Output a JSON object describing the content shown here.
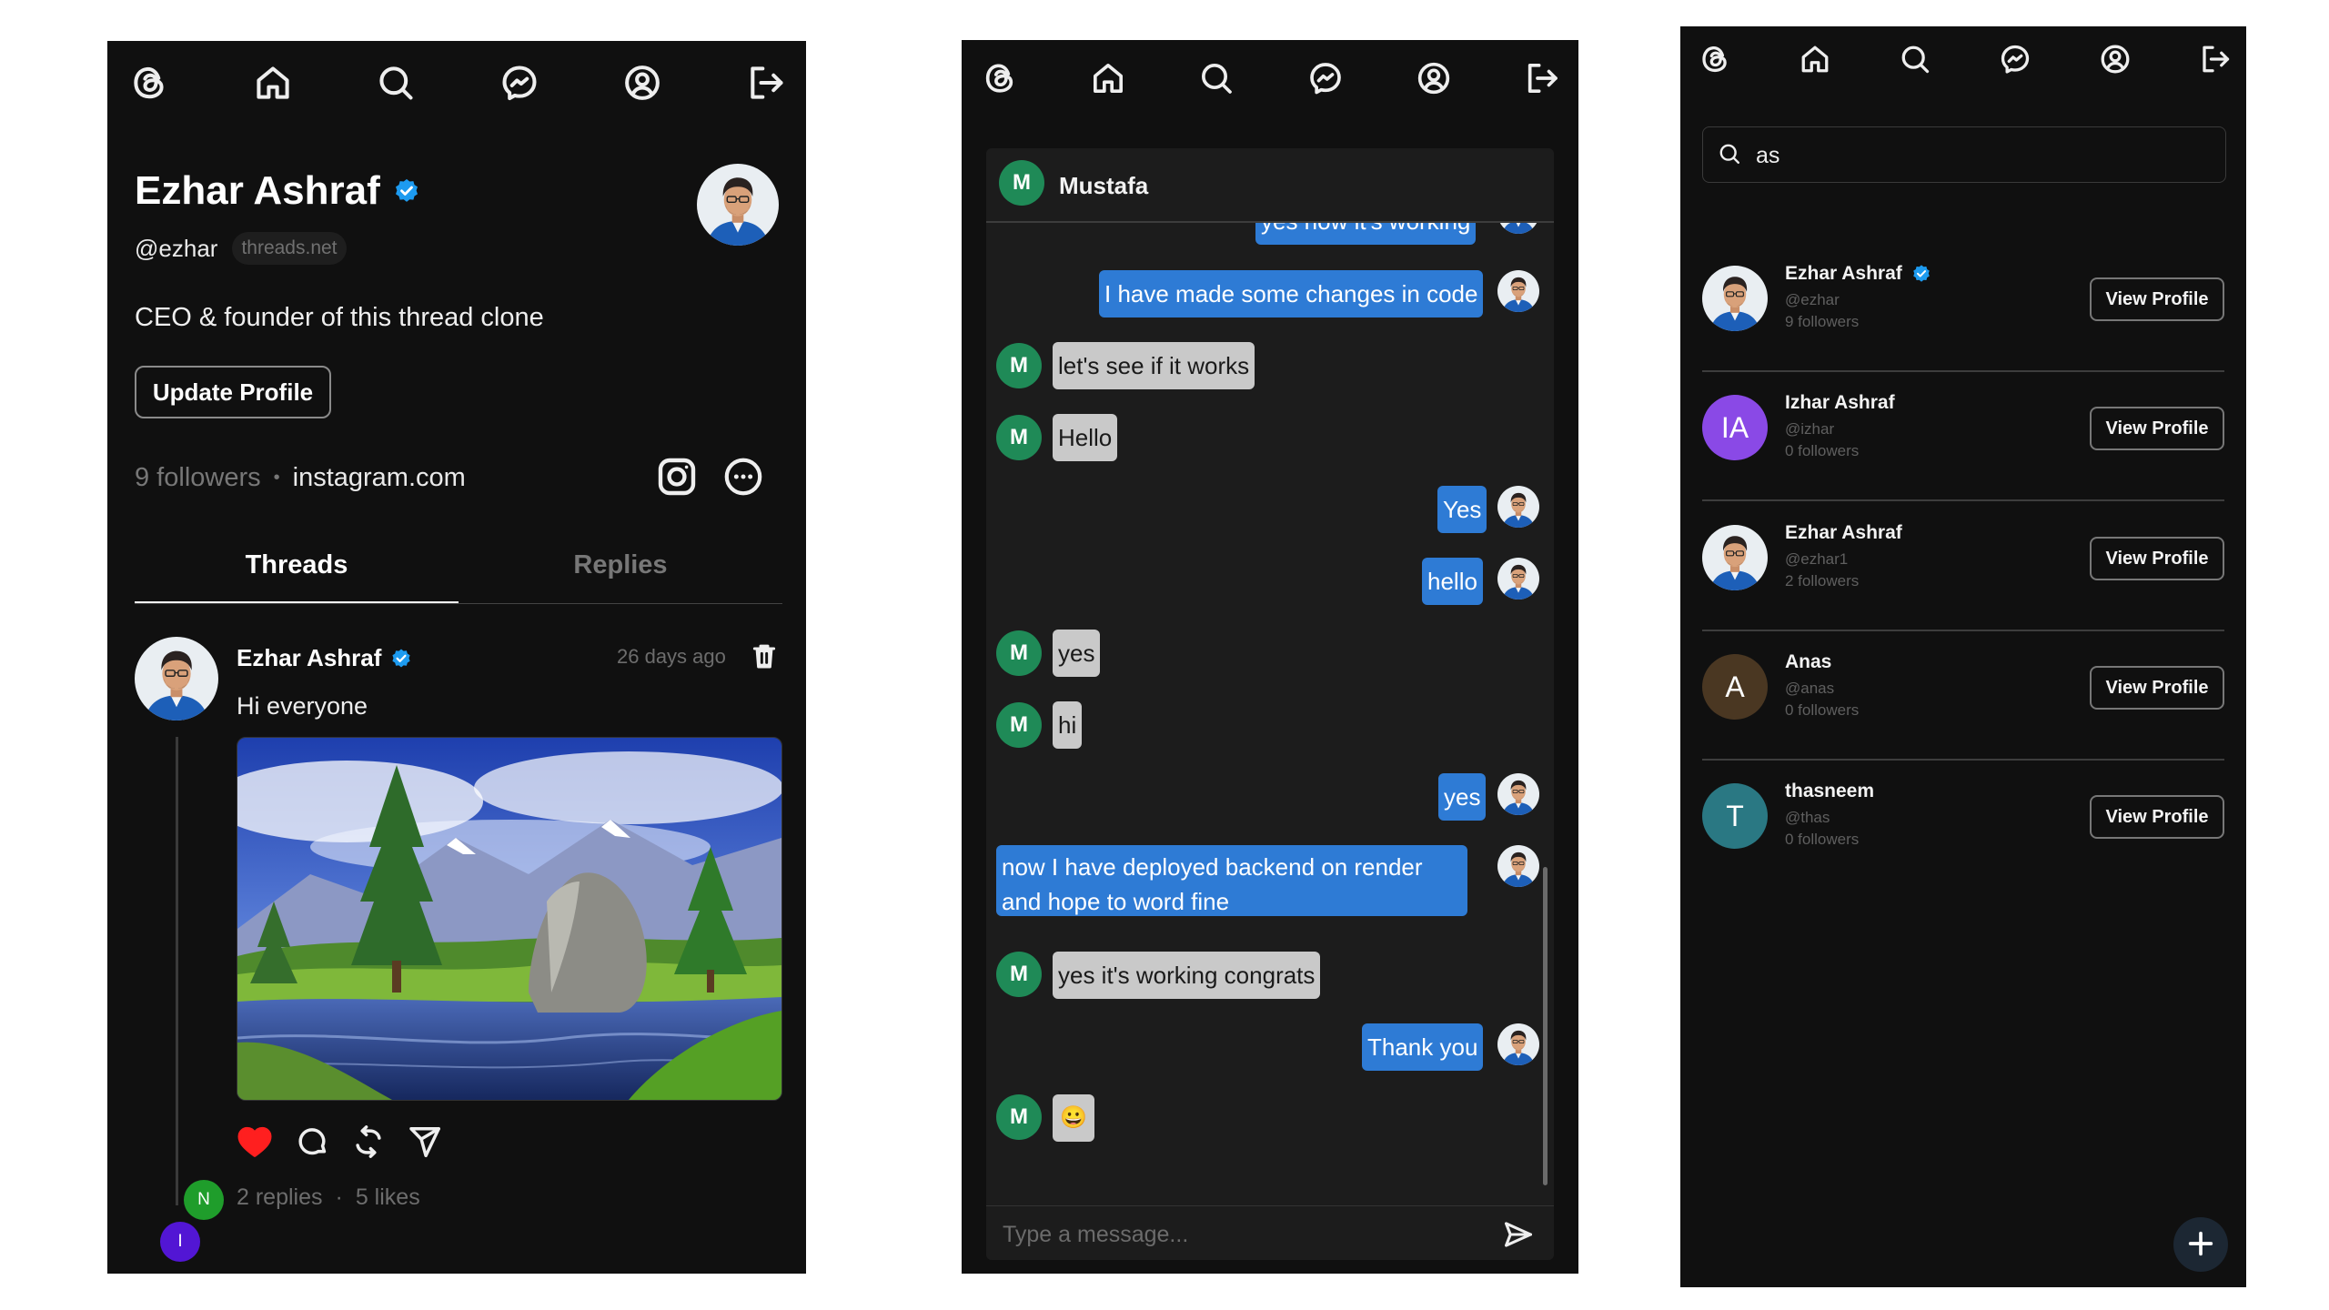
{
  "colors": {
    "verified": "#1d9bf0",
    "my_bubble": "#2e7bd5",
    "their_bubble": "#c9c9c9",
    "mustafa_avatar": "#1f8a57",
    "like_red": "#ff1f1f"
  },
  "nav_icons": [
    "threads-logo-icon",
    "home-icon",
    "search-icon",
    "messenger-icon",
    "profile-icon",
    "logout-icon"
  ],
  "profile": {
    "name": "Ezhar Ashraf",
    "handle": "@ezhar",
    "domain_badge": "threads.net",
    "bio": "CEO & founder of this thread clone",
    "update_button": "Update Profile",
    "followers": "9 followers",
    "separator": "•",
    "website": "instagram.com",
    "tabs": [
      {
        "label": "Threads",
        "active": true
      },
      {
        "label": "Replies",
        "active": false
      }
    ],
    "post": {
      "author": "Ezhar Ashraf",
      "time": "26 days ago",
      "text": "Hi everyone",
      "replies": "2 replies",
      "stats_separator": "·",
      "likes": "5 likes",
      "reply_avatars": [
        "N",
        "I"
      ]
    }
  },
  "chat": {
    "contact": {
      "initial": "M",
      "name": "Mustafa"
    },
    "messages": [
      {
        "from": "me",
        "text": "yes now it's working"
      },
      {
        "from": "me",
        "text": "I have made some changes in code"
      },
      {
        "from": "them",
        "text": "let's see if it works"
      },
      {
        "from": "them",
        "text": "Hello"
      },
      {
        "from": "me",
        "text": "Yes"
      },
      {
        "from": "me",
        "text": "hello"
      },
      {
        "from": "them",
        "text": "yes"
      },
      {
        "from": "them",
        "text": "hi"
      },
      {
        "from": "me",
        "text": "yes"
      },
      {
        "from": "me",
        "text": "now I have deployed backend on render and hope to word fine"
      },
      {
        "from": "them",
        "text": "yes it's working congrats"
      },
      {
        "from": "me",
        "text": "Thank you"
      },
      {
        "from": "them",
        "text": "😀"
      }
    ],
    "input_placeholder": "Type a message..."
  },
  "search": {
    "query": "as",
    "button_label": "View Profile",
    "results": [
      {
        "name": "Ezhar Ashraf",
        "handle": "@ezhar",
        "followers": "9 followers",
        "verified": true,
        "avatar": "photo"
      },
      {
        "name": "Izhar Ashraf",
        "handle": "@izhar",
        "followers": "0 followers",
        "verified": false,
        "avatar": "IA",
        "avatar_color": "#8a49e6"
      },
      {
        "name": "Ezhar Ashraf",
        "handle": "@ezhar1",
        "followers": "2 followers",
        "verified": false,
        "avatar": "photo"
      },
      {
        "name": "Anas",
        "handle": "@anas",
        "followers": "0 followers",
        "verified": false,
        "avatar": "A",
        "avatar_color": "#4a3722"
      },
      {
        "name": "thasneem",
        "handle": "@thas",
        "followers": "0 followers",
        "verified": false,
        "avatar": "T",
        "avatar_color": "#2a7883"
      }
    ]
  }
}
